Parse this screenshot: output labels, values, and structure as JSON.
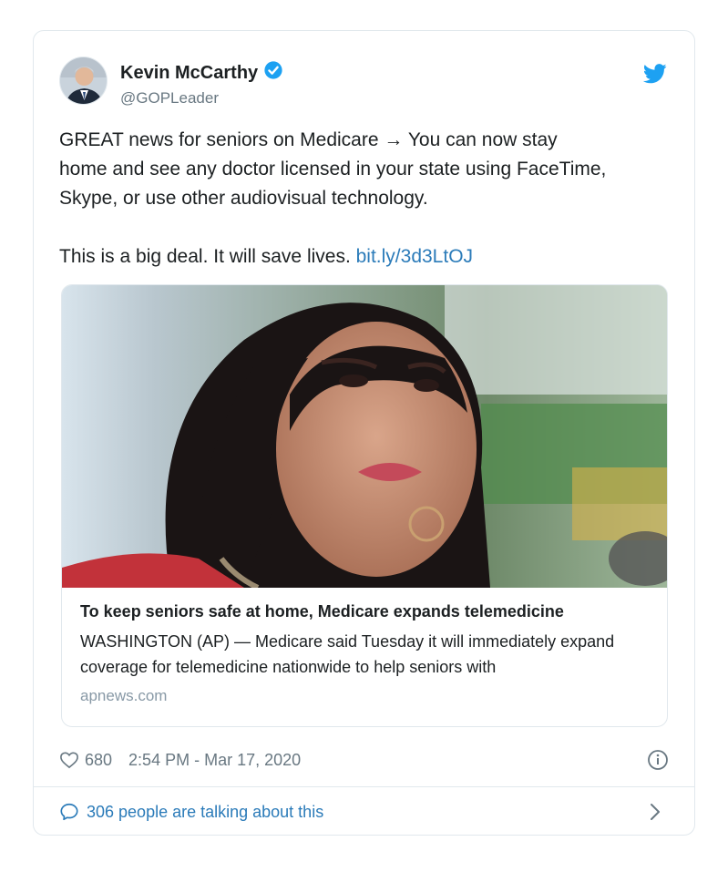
{
  "author": {
    "display_name": "Kevin McCarthy",
    "handle": "@GOPLeader",
    "verified": true
  },
  "tweet": {
    "text_main": "GREAT news for seniors on Medicare → You can now stay\nhome and see any doctor licensed in your state using FaceTime,\nSkype, or use other audiovisual technology.\n\nThis is a big deal. It will save lives. ",
    "link_text": "bit.ly/3d3LtOJ"
  },
  "link_card": {
    "title": "To keep seniors safe at home, Medicare expands telemedicine",
    "description": "WASHINGTON (AP) — Medicare said Tuesday it will immediately expand coverage for telemedicine nationwide to help seniors with",
    "domain": "apnews.com"
  },
  "meta": {
    "likes": "680",
    "timestamp": "2:54 PM - Mar 17, 2020"
  },
  "footer": {
    "talking_text": "306 people are talking about this"
  },
  "icons": {
    "verified": "verified-badge-icon",
    "brand": "twitter-bird-icon",
    "like": "heart-icon",
    "info": "info-icon",
    "reply": "speech-bubble-icon",
    "chevron": "chevron-right-icon"
  },
  "colors": {
    "link": "#2b7bb9",
    "muted": "#697882",
    "twitter_blue": "#1da1f2",
    "border": "#e1e8ed"
  }
}
